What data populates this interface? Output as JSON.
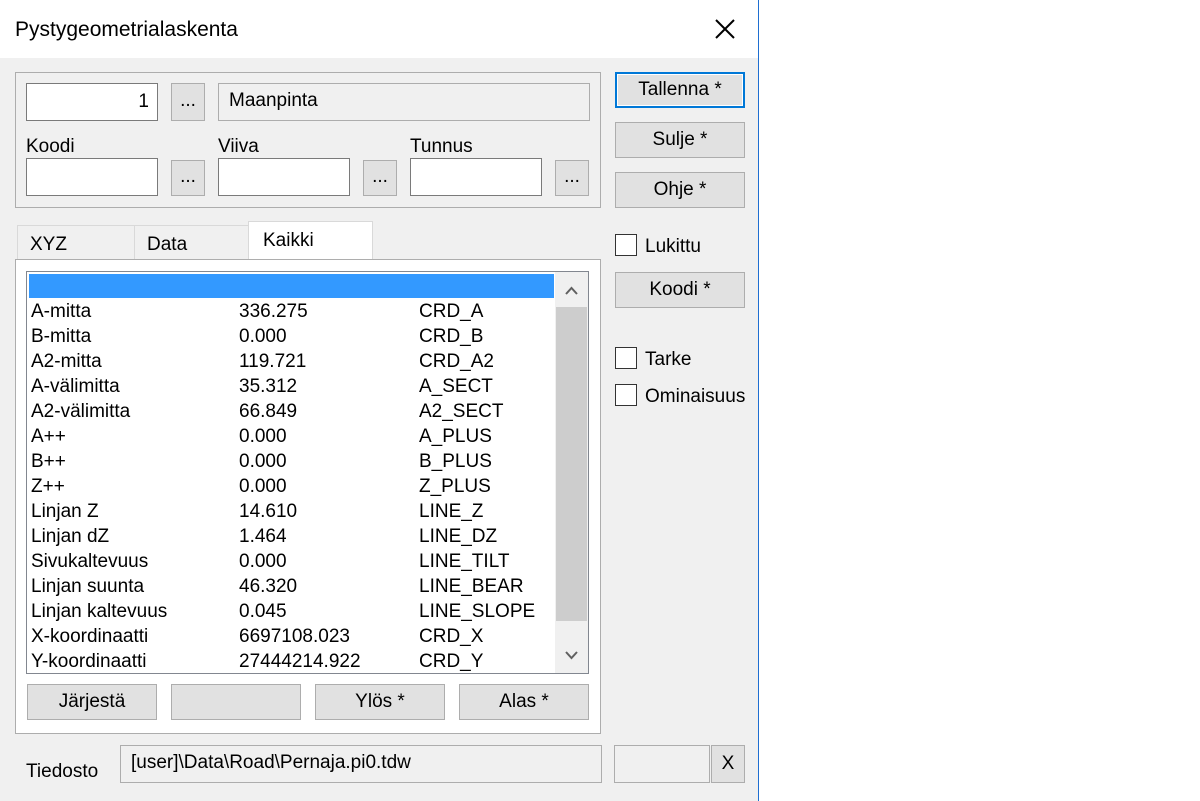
{
  "window": {
    "title": "Pystygeometrialaskenta"
  },
  "top": {
    "number_value": "1",
    "number_browse": "...",
    "name_value": "Maanpinta",
    "koodi_label": "Koodi",
    "viiva_label": "Viiva",
    "tunnus_label": "Tunnus",
    "koodi_value": "",
    "viiva_value": "",
    "tunnus_value": "",
    "browse": "..."
  },
  "side_buttons": {
    "save": "Tallenna *",
    "close": "Sulje *",
    "help": "Ohje *",
    "code": "Koodi *"
  },
  "checkboxes": {
    "locked": "Lukittu",
    "tarke": "Tarke",
    "property": "Ominaisuus"
  },
  "tabs": [
    "XYZ",
    "Data",
    "Kaikki"
  ],
  "list_rows": [
    {
      "name": "A-mitta",
      "value": "336.275",
      "code": "CRD_A"
    },
    {
      "name": "B-mitta",
      "value": "0.000",
      "code": "CRD_B"
    },
    {
      "name": "A2-mitta",
      "value": "119.721",
      "code": "CRD_A2"
    },
    {
      "name": "A-välimitta",
      "value": "35.312",
      "code": "A_SECT"
    },
    {
      "name": "A2-välimitta",
      "value": "66.849",
      "code": "A2_SECT"
    },
    {
      "name": "A++",
      "value": "0.000",
      "code": "A_PLUS"
    },
    {
      "name": "B++",
      "value": "0.000",
      "code": "B_PLUS"
    },
    {
      "name": "Z++",
      "value": "0.000",
      "code": "Z_PLUS"
    },
    {
      "name": "Linjan Z",
      "value": "14.610",
      "code": "LINE_Z"
    },
    {
      "name": "Linjan dZ",
      "value": "1.464",
      "code": "LINE_DZ"
    },
    {
      "name": "Sivukaltevuus",
      "value": "0.000",
      "code": "LINE_TILT"
    },
    {
      "name": "Linjan suunta",
      "value": "46.320",
      "code": "LINE_BEAR"
    },
    {
      "name": "Linjan kaltevuus",
      "value": "0.045",
      "code": "LINE_SLOPE"
    },
    {
      "name": "X-koordinaatti",
      "value": "6697108.023",
      "code": "CRD_X"
    },
    {
      "name": "Y-koordinaatti",
      "value": "27444214.922",
      "code": "CRD_Y"
    }
  ],
  "list_buttons": {
    "sort": "Järjestä",
    "blank": "",
    "up": "Ylös *",
    "down": "Alas *"
  },
  "file": {
    "label": "Tiedosto",
    "path": "[user]\\Data\\Road\\Pernaja.pi0.tdw",
    "extra": "",
    "clear": "X"
  },
  "colors": {
    "selection": "#3399ff",
    "accent": "#0078d7"
  }
}
